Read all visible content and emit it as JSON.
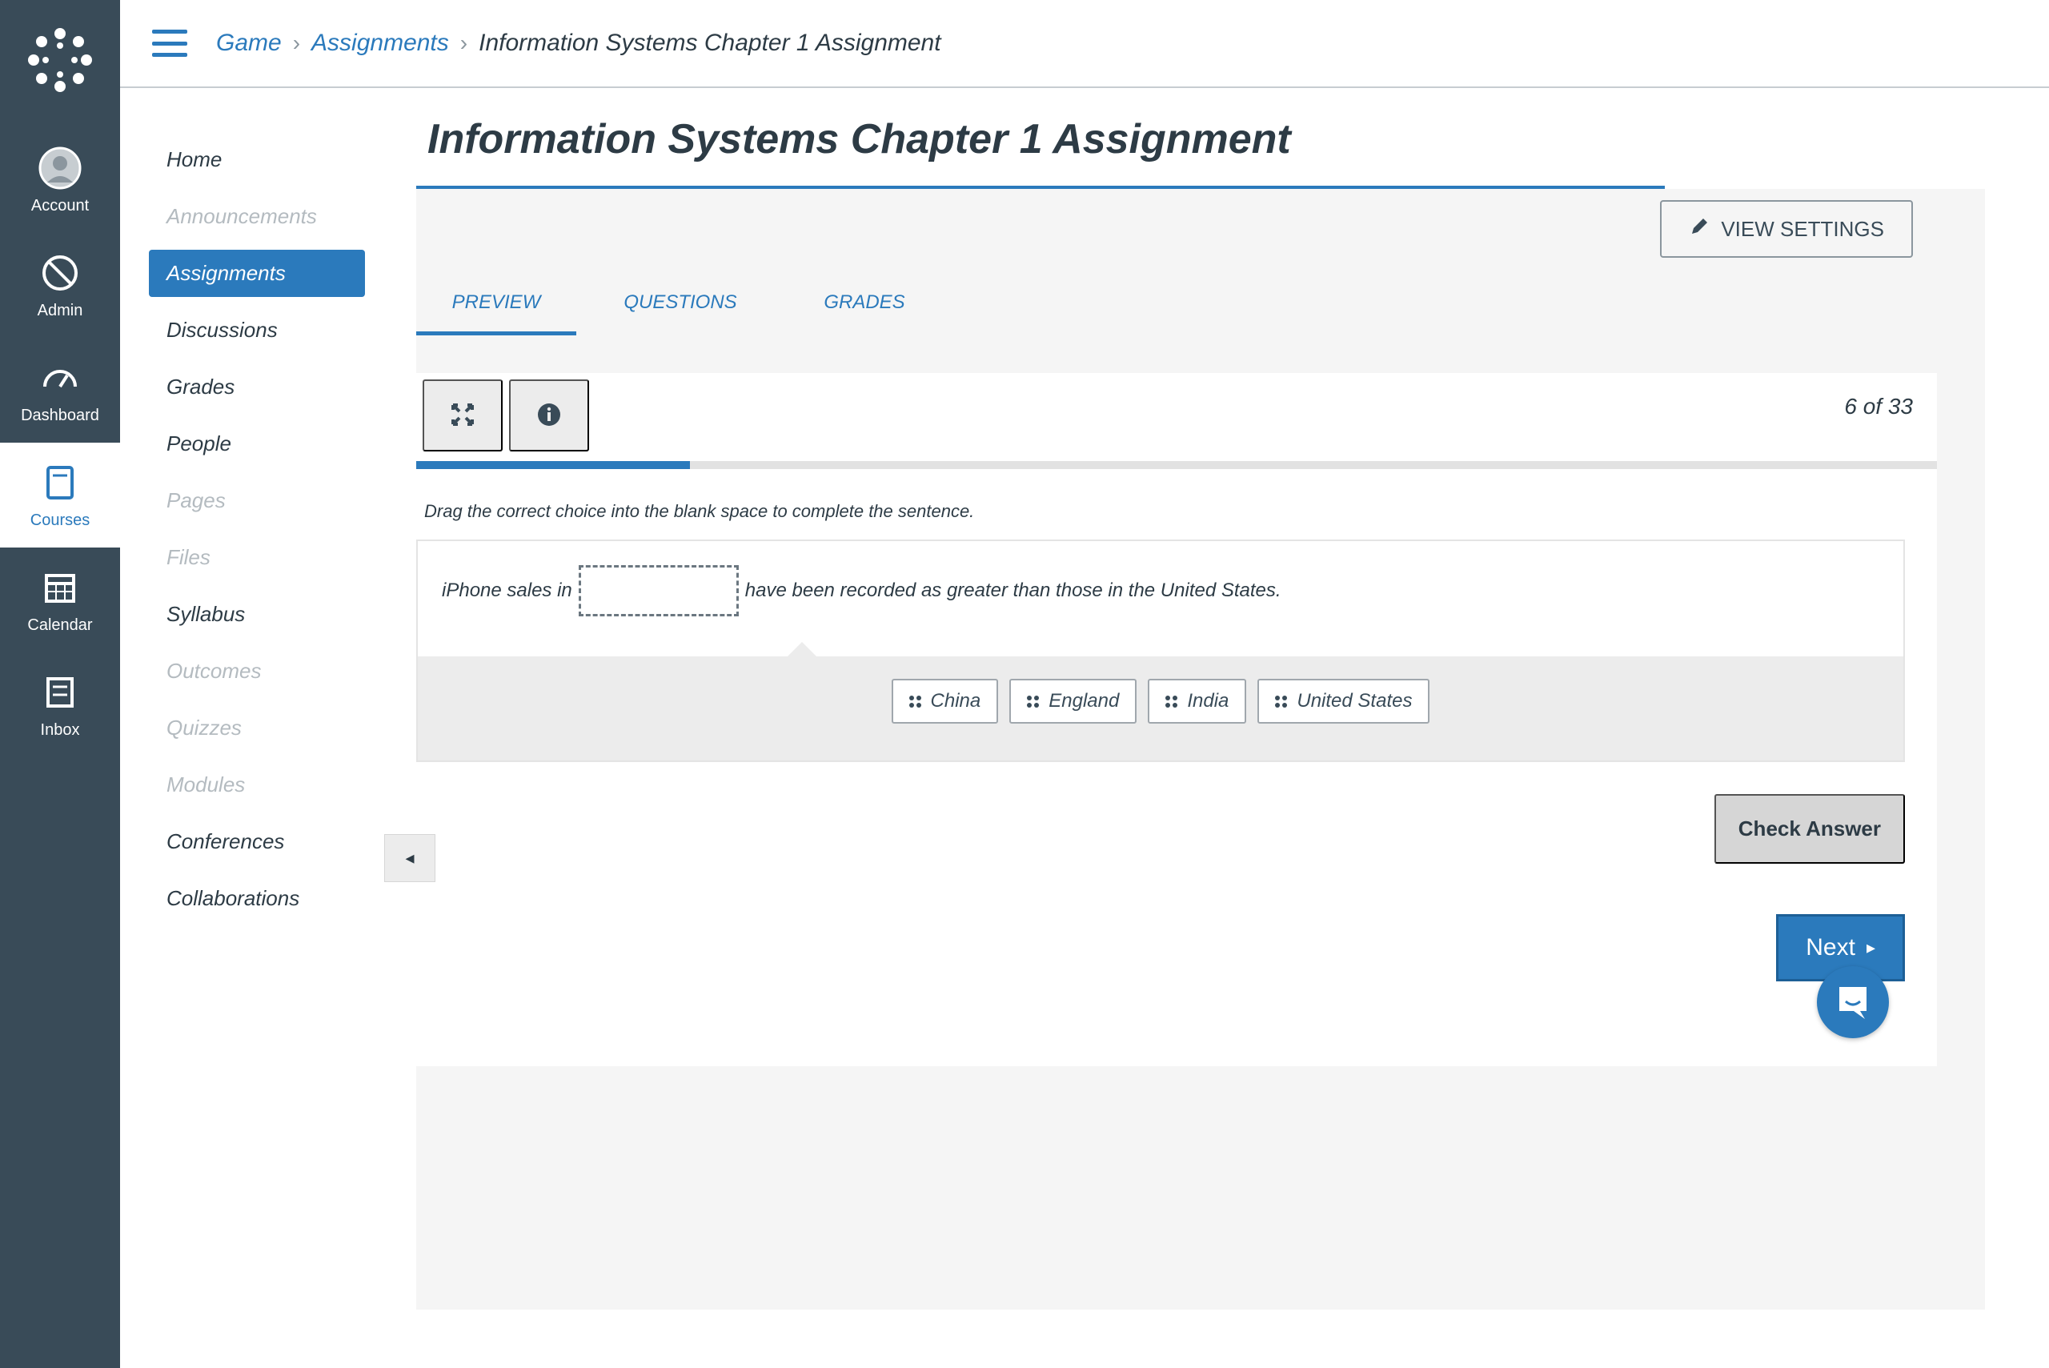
{
  "global_nav": {
    "logo": "canvas-logo-icon",
    "items": [
      {
        "label": "Account",
        "icon": "user-avatar-icon",
        "active": false
      },
      {
        "label": "Admin",
        "icon": "shield-icon",
        "active": false
      },
      {
        "label": "Dashboard",
        "icon": "dashboard-gauge-icon",
        "active": false
      },
      {
        "label": "Courses",
        "icon": "book-icon",
        "active": true
      },
      {
        "label": "Calendar",
        "icon": "calendar-icon",
        "active": false
      },
      {
        "label": "Inbox",
        "icon": "inbox-icon",
        "active": false
      }
    ]
  },
  "header": {
    "breadcrumb": [
      {
        "label": "Game",
        "link": true
      },
      {
        "label": "Assignments",
        "link": true
      },
      {
        "label": "Information Systems Chapter 1 Assignment",
        "link": false
      }
    ],
    "separator": "›"
  },
  "course_nav": {
    "items": [
      {
        "label": "Home",
        "state": "normal"
      },
      {
        "label": "Announcements",
        "state": "disabled"
      },
      {
        "label": "Assignments",
        "state": "active"
      },
      {
        "label": "Discussions",
        "state": "normal"
      },
      {
        "label": "Grades",
        "state": "normal"
      },
      {
        "label": "People",
        "state": "normal"
      },
      {
        "label": "Pages",
        "state": "disabled"
      },
      {
        "label": "Files",
        "state": "disabled"
      },
      {
        "label": "Syllabus",
        "state": "normal"
      },
      {
        "label": "Outcomes",
        "state": "disabled"
      },
      {
        "label": "Quizzes",
        "state": "disabled"
      },
      {
        "label": "Modules",
        "state": "disabled"
      },
      {
        "label": "Conferences",
        "state": "normal"
      },
      {
        "label": "Collaborations",
        "state": "normal"
      }
    ]
  },
  "main": {
    "title": "Information Systems Chapter 1 Assignment",
    "view_settings_label": "VIEW SETTINGS",
    "tabs": [
      {
        "label": "PREVIEW",
        "active": true
      },
      {
        "label": "QUESTIONS",
        "active": false
      },
      {
        "label": "GRADES",
        "active": false
      }
    ],
    "quiz": {
      "toolbar": {
        "fullscreen_icon": "expand-arrows-icon",
        "info_icon": "info-icon"
      },
      "counter": "6 of 33",
      "progress_fraction": 0.18,
      "instruction": "Drag the correct choice into the blank space to complete the sentence.",
      "sentence_before": "iPhone sales in",
      "sentence_after": "have been recorded as greater than those in the United States.",
      "blank_value": "",
      "choices": [
        "China",
        "England",
        "India",
        "United States"
      ],
      "check_answer_label": "Check Answer",
      "prev_label": "◂",
      "next_label": "Next",
      "next_icon": "▸"
    },
    "chat_icon": "chat-bubble-smile-icon"
  },
  "colors": {
    "accent": "#2b7abc",
    "global_nav_bg": "#394b58",
    "text": "#2d3b45"
  }
}
